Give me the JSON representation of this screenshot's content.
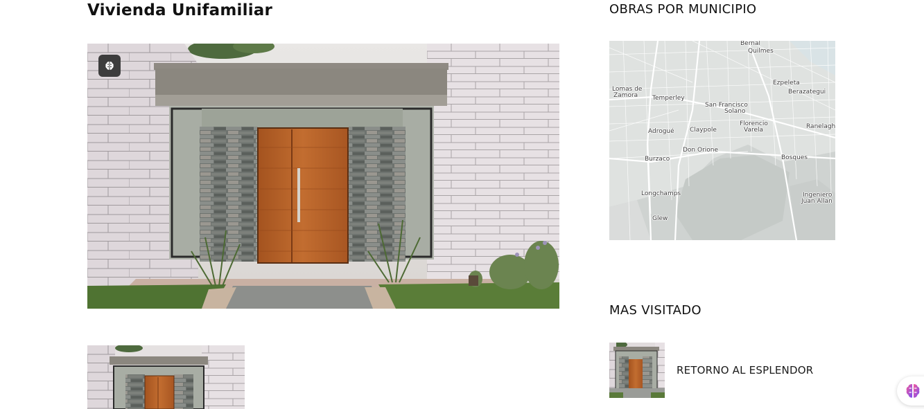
{
  "article": {
    "title": "Vivienda Unifamiliar",
    "hero_badge_icon": "brain-icon",
    "gallery": [
      "house-entrance-thumbnail"
    ]
  },
  "sidebar": {
    "map_section": {
      "title": "OBRAS POR MUNICIPIO",
      "labels": {
        "bernal": "Bernal",
        "quilmes": "Quilmes",
        "lomas": "Lomas de",
        "zamora": "Zamora",
        "temperley": "Temperley",
        "ezpeleta": "Ezpeleta",
        "berazategui": "Berazategui",
        "sanfrancisco": "San Francisco",
        "solano": "Solano",
        "adrogue": "Adrogué",
        "claypole": "Claypole",
        "florencio": "Florencio",
        "varela": "Varela",
        "ranelagh": "Ranelagh",
        "donorione": "Don Orione",
        "burzaco": "Burzaco",
        "bosques": "Bosques",
        "longchamps": "Longchamps",
        "ingeniero": "Ingeniero",
        "juanallan": "Juan Allan",
        "glew": "Glew"
      }
    },
    "most_visited": {
      "title": "MAS VISITADO",
      "items": [
        {
          "label": "RETORNO AL ESPLENDOR"
        }
      ]
    }
  },
  "floating_assistant": {
    "icon": "brain-icon"
  },
  "colors": {
    "wall": "#e2dadd",
    "door": "#b5622a",
    "stone": "#6f7470",
    "grass": "#5a7a3a",
    "map_land": "#cfd3d1",
    "map_urban": "#dfe2e0",
    "map_water": "#d6e0e2"
  }
}
